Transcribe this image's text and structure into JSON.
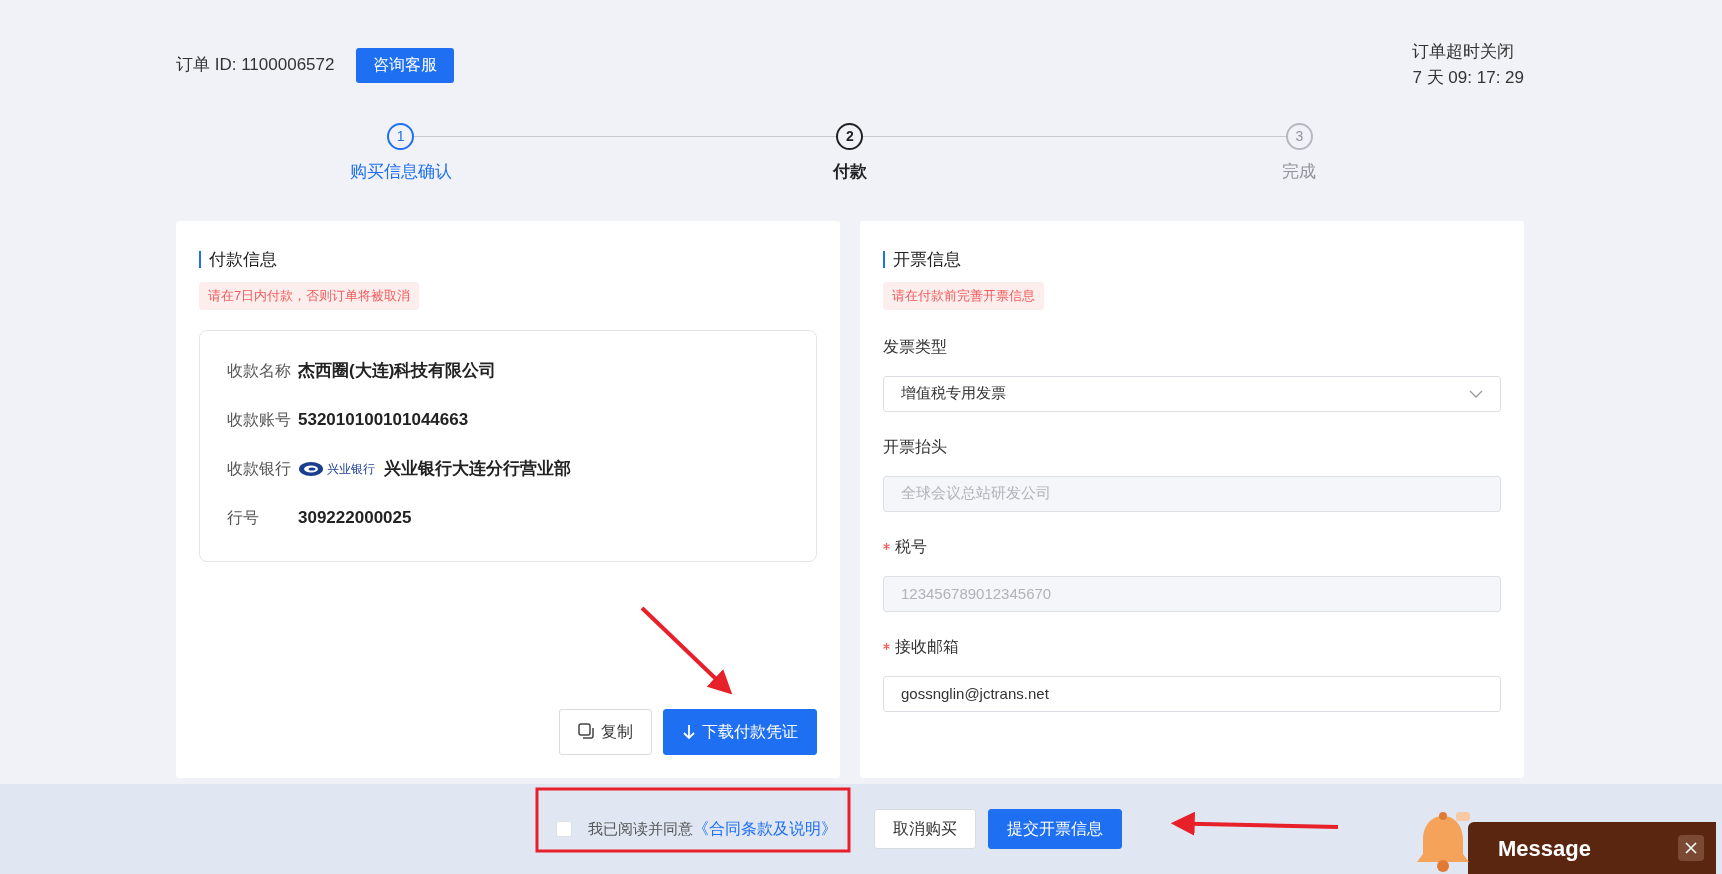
{
  "header": {
    "order_id": "订单 ID: 1100006572",
    "contact_button": "咨询客服",
    "timeout_label": "订单超时关闭",
    "countdown": "7 天 09: 17: 29"
  },
  "steps": [
    {
      "number": "1",
      "label": "购买信息确认",
      "completed": true,
      "selected": false
    },
    {
      "number": "2",
      "label": "付款",
      "completed": false,
      "selected": true
    },
    {
      "number": "3",
      "label": "完成",
      "completed": false,
      "selected": false
    }
  ],
  "payment": {
    "title": "付款信息",
    "notice": "请在7日内付款，否则订单将被取消",
    "rows": [
      {
        "kind": "text",
        "label": "收款名称",
        "value": "杰西圈(大连)科技有限公司"
      },
      {
        "kind": "text",
        "label": "收款账号",
        "value": "532010100101044663"
      },
      {
        "kind": "bank",
        "label": "收款银行",
        "logo_text": "兴业银行",
        "value": "兴业银行大连分行营业部"
      },
      {
        "kind": "text",
        "label": "行号",
        "value": "309222000025"
      }
    ],
    "buttons": [
      {
        "kind": "secondary",
        "label": "复制"
      },
      {
        "kind": "primary",
        "label": "下载付款凭证"
      }
    ]
  },
  "invoice": {
    "title": "开票信息",
    "notice": "请在付款前完善开票信息",
    "fields": [
      {
        "kind": "select",
        "label": "发票类型",
        "required": false,
        "disabled": false,
        "value": "增值税专用发票"
      },
      {
        "kind": "input",
        "label": "开票抬头",
        "required": false,
        "disabled": true,
        "value": "全球会议总站研发公司"
      },
      {
        "kind": "input",
        "label": "税号",
        "required": true,
        "disabled": true,
        "value": "123456789012345670"
      },
      {
        "kind": "input",
        "label": "接收邮箱",
        "required": true,
        "disabled": false,
        "value": "gossnglin@jctrans.net"
      }
    ]
  },
  "footer": {
    "agreement": {
      "checked": false,
      "text": "我已阅读并同意",
      "link": "《合同条款及说明》"
    },
    "buttons": [
      {
        "kind": "secondary",
        "label": "取消购买"
      },
      {
        "kind": "primary",
        "label": "提交开票信息"
      }
    ]
  },
  "message_widget": {
    "label": "Message"
  },
  "annotations": [
    {
      "kind": "frame"
    },
    {
      "kind": "arrow"
    },
    {
      "kind": "arrow"
    }
  ]
}
